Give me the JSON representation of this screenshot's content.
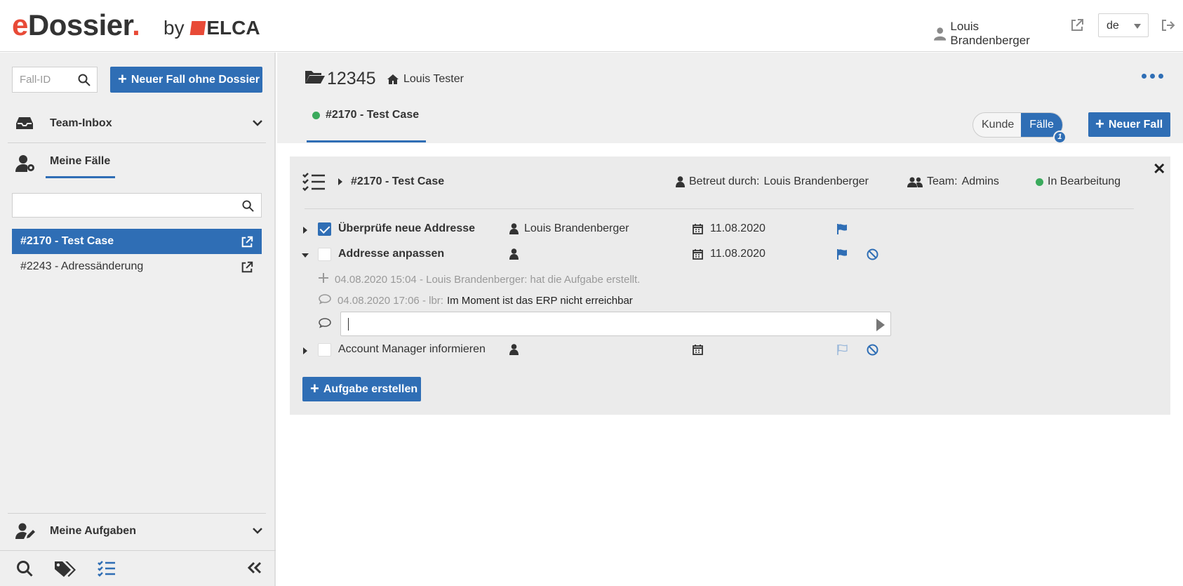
{
  "header": {
    "logo_e": "e",
    "logo_rest": "Dossier",
    "logo_dot": ".",
    "by": "by",
    "elca": "ELCA",
    "user_name": "Louis Brandenberger",
    "language": "de",
    "icons": [
      "user-icon",
      "external-link-icon",
      "logout-icon"
    ]
  },
  "sidebar": {
    "fall_id_placeholder": "Fall-ID",
    "new_case_button": "Neuer Fall ohne Dossier",
    "team_inbox": "Team-Inbox",
    "my_cases": "Meine Fälle",
    "search_value": "",
    "cases": [
      {
        "label": "#2170 - Test Case",
        "active": true
      },
      {
        "label": "#2243 - Adressänderung",
        "active": false
      }
    ],
    "my_tasks": "Meine Aufgaben",
    "tools": [
      "search-icon",
      "tags-icon",
      "tasks-icon",
      "collapse-icon"
    ]
  },
  "dossier": {
    "number": "12345",
    "owner": "Louis Tester",
    "tab": "#2170 - Test Case",
    "toggle_kunde": "Kunde",
    "toggle_faelle": "Fälle",
    "faelle_badge": "1",
    "new_case_button": "Neuer Fall"
  },
  "case": {
    "title": "#2170 - Test Case",
    "assigned_label": "Betreut durch:",
    "assigned_value": "Louis Brandenberger",
    "team_label": "Team:",
    "team_value": "Admins",
    "status": "In Bearbeitung",
    "status_color": "#3aaa5c",
    "tasks": [
      {
        "name": "Überprüfe neue Addresse",
        "person": "Louis Brandenberger",
        "date": "11.08.2020",
        "done": true,
        "flag": "filled"
      },
      {
        "name": "Addresse anpassen",
        "person": "",
        "date": "11.08.2020",
        "done": false,
        "flag": "filled"
      },
      {
        "name": "Account Manager informieren",
        "person": "",
        "date": "",
        "done": false,
        "flag": "outline"
      }
    ],
    "log": [
      {
        "meta": "04.08.2020 15:04 - Louis Brandenberger: hat die Aufgabe erstellt.",
        "text": ""
      },
      {
        "meta": "04.08.2020 17:06 - lbr:",
        "text": "Im Moment ist das ERP nicht erreichbar"
      }
    ],
    "comment_value": "",
    "create_task_button": "Aufgabe erstellen"
  },
  "colors": {
    "primary": "#2f6eb5",
    "brand_red": "#e84a37",
    "status_green": "#3aaa5c"
  }
}
